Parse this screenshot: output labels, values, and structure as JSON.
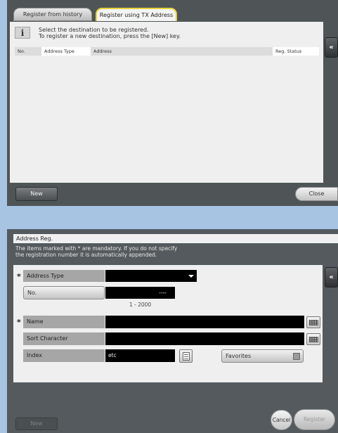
{
  "top": {
    "tabs": [
      {
        "label": "Register from history"
      },
      {
        "label": "Register using TX Address"
      }
    ],
    "info_icon": "i",
    "info_line1": "Select the destination to be registered.",
    "info_line2": "To register a new destination, press the [New] key.",
    "columns": [
      "No.",
      "Address Type",
      "Address",
      "Reg. Status"
    ],
    "new_label": "New",
    "close_label": "Close",
    "side_arrow": "«"
  },
  "bottom": {
    "title": "Address Reg.",
    "desc_line1": "The items marked with * are mandatory. If you do not specify",
    "desc_line2": "the registration number it is automatically appended.",
    "mandatory_mark": "*",
    "address_type_label": "Address Type",
    "address_type_value": "",
    "no_label": "No.",
    "no_value": "----",
    "no_range": "1 - 2000",
    "name_label": "Name",
    "name_value": "",
    "sort_label": "Sort Character",
    "sort_value": "",
    "index_label": "Index",
    "index_value": "etc",
    "favorites_label": "Favorites",
    "favorites_checked": false,
    "cancel_label": "Cancel",
    "register_label": "Register",
    "new_label": "New",
    "side_arrow": "«"
  }
}
